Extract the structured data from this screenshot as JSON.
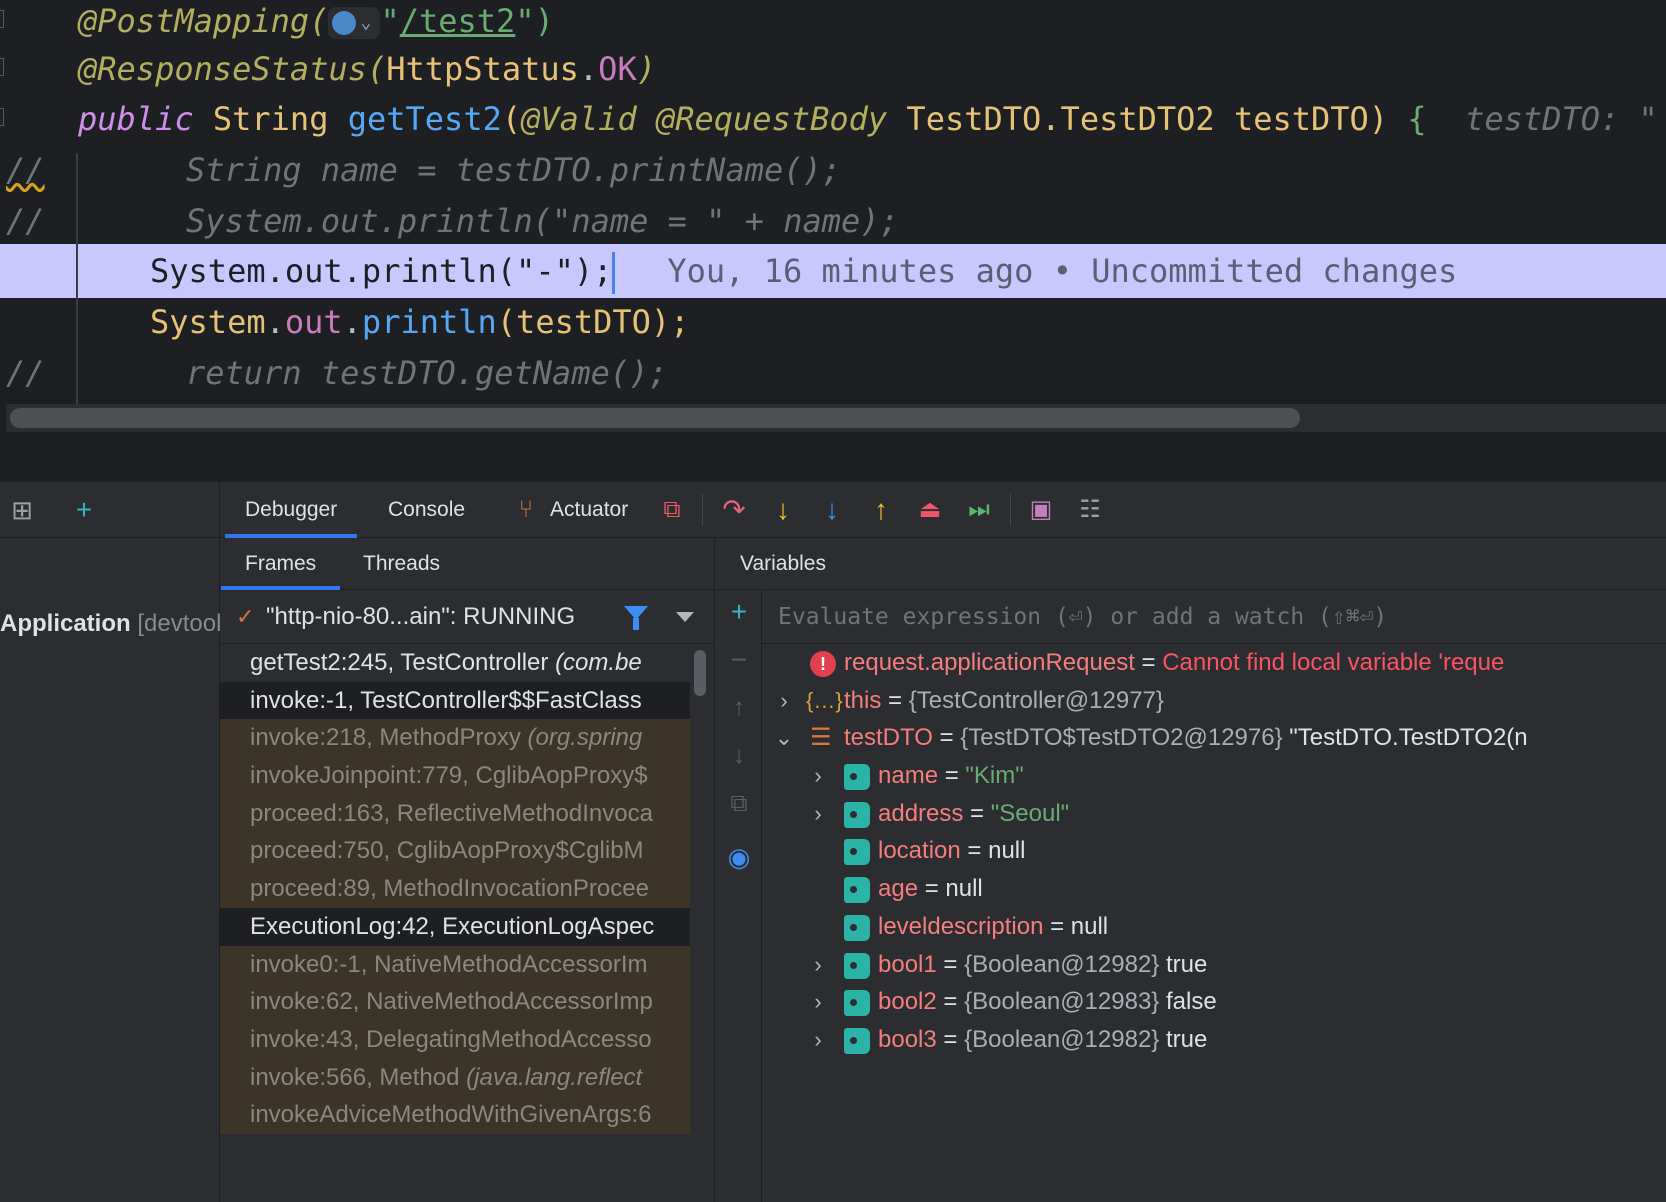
{
  "editor": {
    "lines": [
      {
        "id": "l1",
        "gutter": "",
        "segments": [
          {
            "t": "@PostMapping(",
            "c": "ann"
          },
          {
            "t": "globe"
          },
          {
            "t": "\"",
            "c": "str"
          },
          {
            "t": "/test2",
            "c": "strlink"
          },
          {
            "t": "\")",
            "c": "str"
          }
        ]
      },
      {
        "id": "l2",
        "gutter": "",
        "segments": [
          {
            "t": "@ResponseStatus(",
            "c": "ann"
          },
          {
            "t": "HttpStatus",
            "c": "typ"
          },
          {
            "t": ".",
            "c": "plain"
          },
          {
            "t": "OK",
            "c": "field"
          },
          {
            "t": ")",
            "c": "ann"
          }
        ]
      },
      {
        "id": "l3",
        "gutter": "",
        "segments": [
          {
            "t": "public ",
            "c": "kw"
          },
          {
            "t": "String ",
            "c": "typ"
          },
          {
            "t": "getTest2",
            "c": "fn"
          },
          {
            "t": "(",
            "c": "typ"
          },
          {
            "t": "@Valid @RequestBody ",
            "c": "ann"
          },
          {
            "t": "TestDTO.TestDTO2 ",
            "c": "typ"
          },
          {
            "t": "testDTO",
            "c": "param"
          },
          {
            "t": ") ",
            "c": "typ"
          },
          {
            "t": "{",
            "c": "brace-g"
          },
          {
            "t": "  testDTO: \"",
            "c": "hint"
          }
        ]
      },
      {
        "id": "l4",
        "gutter": "//",
        "segments": [
          {
            "t": "String name = testDTO.printName();",
            "c": "cmt"
          }
        ]
      },
      {
        "id": "l5",
        "gutter": "//",
        "segments": [
          {
            "t": "System.out.println(\"name = \" + name);",
            "c": "cmt"
          }
        ]
      },
      {
        "id": "l6",
        "gutter": "",
        "segments": [
          {
            "t": "System.out.println(\"-\");",
            "c": "cur-text"
          }
        ]
      },
      {
        "id": "l7",
        "gutter": "",
        "segments": [
          {
            "t": "System",
            "c": "typ"
          },
          {
            "t": ".",
            "c": "plain"
          },
          {
            "t": "out",
            "c": "field"
          },
          {
            "t": ".",
            "c": "plain"
          },
          {
            "t": "println",
            "c": "fn"
          },
          {
            "t": "(",
            "c": "typ"
          },
          {
            "t": "testDTO",
            "c": "param"
          },
          {
            "t": ");",
            "c": "typ"
          }
        ]
      },
      {
        "id": "l8",
        "gutter": "//",
        "segments": [
          {
            "t": "return testDTO.getName();",
            "c": "cmt"
          }
        ]
      }
    ],
    "blame": "You, 16 minutes ago • Uncommitted changes"
  },
  "toolbar": {
    "tabs": [
      "Debugger",
      "Console",
      "Actuator"
    ],
    "active_tab": "Debugger",
    "icons": [
      "layout-icon",
      "add-icon",
      "restore-layout-icon",
      "step-over-icon",
      "step-into-icon",
      "force-step-into-icon",
      "step-out-icon",
      "drop-frame-icon",
      "run-to-cursor-icon",
      "evaluate-icon",
      "settings-list-icon"
    ]
  },
  "side": {
    "app_name": "Application",
    "app_suffix": "[devtools]"
  },
  "frames": {
    "tabs": [
      "Frames",
      "Threads"
    ],
    "thread": "\"http-nio-80...ain\": RUNNING",
    "items": [
      {
        "text": "getTest2:245, TestController ",
        "pkg": "(com.be",
        "kind": "selected"
      },
      {
        "text": "invoke:-1, TestController$$FastClass",
        "pkg": "",
        "kind": "user"
      },
      {
        "text": "invoke:218, MethodProxy ",
        "pkg": "(org.spring",
        "kind": "lib"
      },
      {
        "text": "invokeJoinpoint:779, CglibAopProxy$",
        "pkg": "",
        "kind": "lib"
      },
      {
        "text": "proceed:163, ReflectiveMethodInvoca",
        "pkg": "",
        "kind": "lib"
      },
      {
        "text": "proceed:750, CglibAopProxy$CglibM",
        "pkg": "",
        "kind": "lib"
      },
      {
        "text": "proceed:89, MethodInvocationProcee",
        "pkg": "",
        "kind": "lib"
      },
      {
        "text": "ExecutionLog:42, ExecutionLogAspec",
        "pkg": "",
        "kind": "user"
      },
      {
        "text": "invoke0:-1, NativeMethodAccessorIm",
        "pkg": "",
        "kind": "lib"
      },
      {
        "text": "invoke:62, NativeMethodAccessorImp",
        "pkg": "",
        "kind": "lib"
      },
      {
        "text": "invoke:43, DelegatingMethodAccesso",
        "pkg": "",
        "kind": "lib"
      },
      {
        "text": "invoke:566, Method ",
        "pkg": "(java.lang.reflect",
        "kind": "lib"
      },
      {
        "text": "invokeAdviceMethodWithGivenArgs:6",
        "pkg": "",
        "kind": "lib"
      }
    ]
  },
  "variables": {
    "title": "Variables",
    "eval_placeholder": "Evaluate expression (⏎) or add a watch (⇧⌘⏎)",
    "items": [
      {
        "depth": 0,
        "chev": "",
        "icon": "error",
        "name": "request.applicationRequest",
        "eq": " = ",
        "ref": "",
        "value": "Cannot find local variable 'reque",
        "vclass": "verr"
      },
      {
        "depth": 0,
        "chev": "›",
        "icon": "brace",
        "name": "this",
        "eq": " = ",
        "ref": "{TestController@12977}",
        "value": "",
        "vclass": "vref"
      },
      {
        "depth": 0,
        "chev": "⌄",
        "icon": "obj",
        "name": "testDTO",
        "eq": " = ",
        "ref": "{TestDTO$TestDTO2@12976} ",
        "value": "\"TestDTO.TestDTO2(n",
        "vclass": "vnull"
      },
      {
        "depth": 1,
        "chev": "›",
        "icon": "tag",
        "name": "name",
        "eq": " = ",
        "ref": "",
        "value": "\"Kim\"",
        "vclass": "vstr"
      },
      {
        "depth": 1,
        "chev": "›",
        "icon": "tag",
        "name": "address",
        "eq": " = ",
        "ref": "",
        "value": "\"Seoul\"",
        "vclass": "vstr"
      },
      {
        "depth": 1,
        "chev": "",
        "icon": "tag",
        "name": "location",
        "eq": " = ",
        "ref": "",
        "value": "null",
        "vclass": "vnull"
      },
      {
        "depth": 1,
        "chev": "",
        "icon": "tag",
        "name": "age",
        "eq": " = ",
        "ref": "",
        "value": "null",
        "vclass": "vnull"
      },
      {
        "depth": 1,
        "chev": "",
        "icon": "tag",
        "name": "leveldescription",
        "eq": " = ",
        "ref": "",
        "value": "null",
        "vclass": "vnull"
      },
      {
        "depth": 1,
        "chev": "›",
        "icon": "tag",
        "name": "bool1",
        "eq": " = ",
        "ref": "{Boolean@12982} ",
        "value": "true",
        "vclass": "vnull"
      },
      {
        "depth": 1,
        "chev": "›",
        "icon": "tag",
        "name": "bool2",
        "eq": " = ",
        "ref": "{Boolean@12983} ",
        "value": "false",
        "vclass": "vnull"
      },
      {
        "depth": 1,
        "chev": "›",
        "icon": "tag",
        "name": "bool3",
        "eq": " = ",
        "ref": "{Boolean@12982} ",
        "value": "true",
        "vclass": "vnull"
      }
    ]
  },
  "colors": {
    "accent": "#3574f0",
    "current_line": "#c8c8ff",
    "library_frame": "#3d3428",
    "error": "#f75464"
  }
}
